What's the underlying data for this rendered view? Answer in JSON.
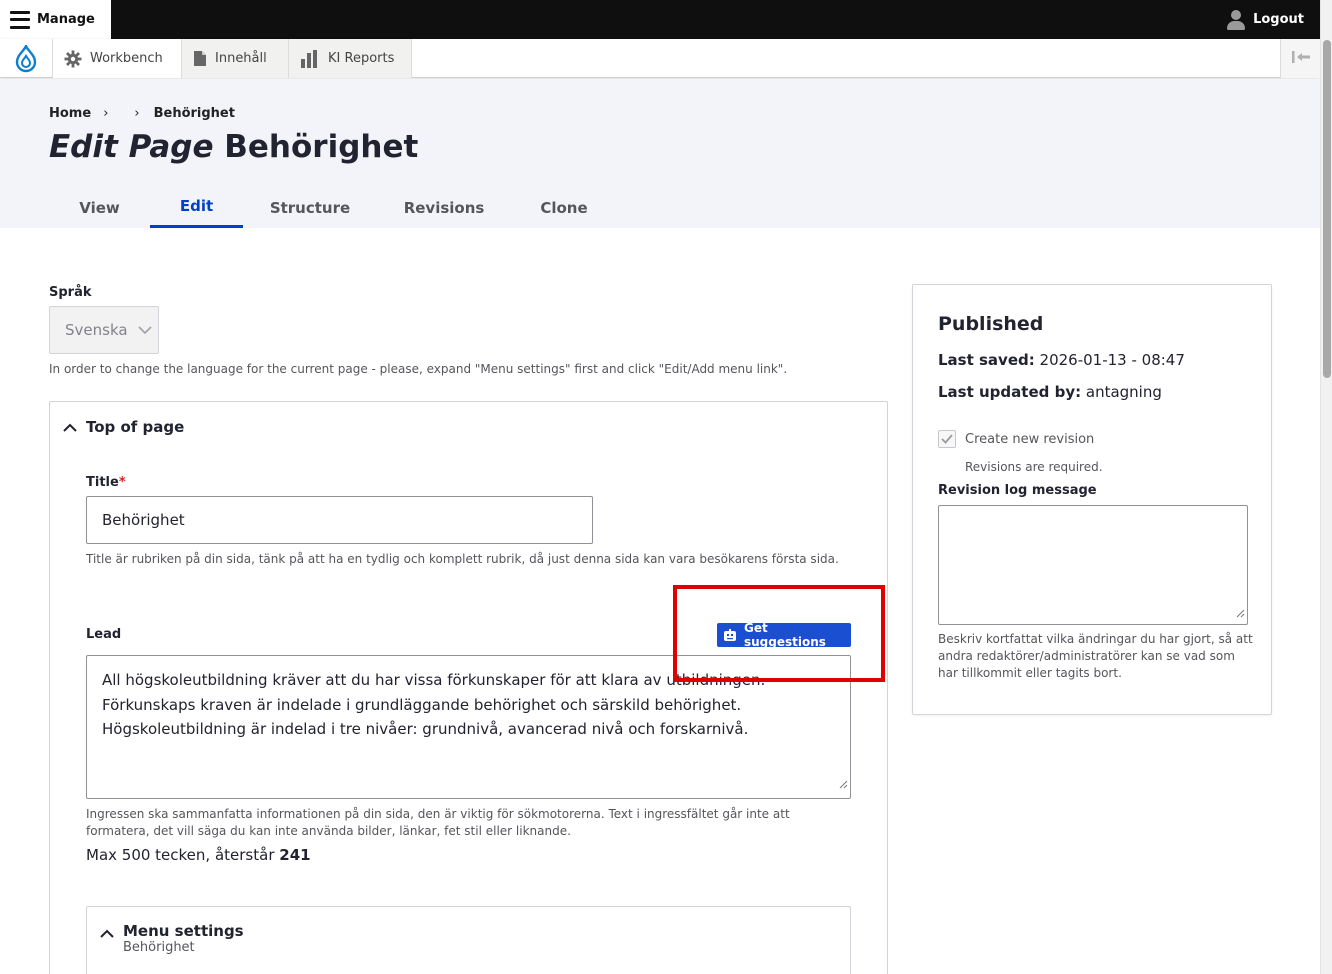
{
  "toolbar": {
    "manage_label": "Manage",
    "logout_label": "Logout"
  },
  "tray": {
    "items": [
      {
        "label": "Workbench",
        "icon": "gear-icon"
      },
      {
        "label": "Innehåll",
        "icon": "document-icon"
      },
      {
        "label": "KI Reports",
        "icon": "bar-chart-icon"
      }
    ]
  },
  "breadcrumb": {
    "home": "Home",
    "current": "Behörighet"
  },
  "page": {
    "title_prefix": "Edit Page",
    "title_name": "Behörighet"
  },
  "tabs": [
    {
      "label": "View",
      "active": false
    },
    {
      "label": "Edit",
      "active": true
    },
    {
      "label": "Structure",
      "active": false
    },
    {
      "label": "Revisions",
      "active": false
    },
    {
      "label": "Clone",
      "active": false
    }
  ],
  "language": {
    "label": "Språk",
    "value": "Svenska",
    "description": "In order to change the language for the current page - please, expand \"Menu settings\" first and click \"Edit/Add menu link\"."
  },
  "top_of_page": {
    "summary": "Top of page",
    "title_field": {
      "label": "Title",
      "required_mark": "*",
      "value": "Behörighet",
      "description": "Title är rubriken på din sida, tänk på att ha en tydlig och komplett rubrik, då just denna sida kan vara besökarens första sida."
    },
    "lead_field": {
      "label": "Lead",
      "suggest_button": "Get suggestions",
      "value": "All högskoleutbildning kräver att du har vissa förkunskaper för att klara av utbildningen. Förkunskaps kraven är indelade i grundläggande behörighet och särskild behörighet. Högskoleutbildning är indelad i tre nivåer: grundnivå, avancerad nivå och forskarnivå.",
      "description": "Ingressen ska sammanfatta informationen på din sida, den är viktig för sökmotorerna. Text i ingressfältet går inte att formatera, det vill säga du kan inte använda bilder, länkar, fet stil eller liknande.",
      "counter_text": "Max 500 tecken, återstår",
      "counter_value": "241"
    },
    "menu_settings": {
      "title": "Menu settings",
      "subtitle": "Behörighet"
    }
  },
  "meta": {
    "status": "Published",
    "last_saved_label": "Last saved:",
    "last_saved_value": "2026-01-13 - 08:47",
    "last_updated_label": "Last updated by:",
    "last_updated_value": "antagning",
    "create_revision_label": "Create new revision",
    "create_revision_checked": true,
    "revision_required_text": "Revisions are required.",
    "revision_log_label": "Revision log message",
    "revision_log_value": "",
    "revision_log_description": "Beskriv kortfattat vilka ändringar du har gjort, så att andra redaktörer/administratörer kan se vad som har tillkommit eller tagits bort."
  },
  "colors": {
    "accent": "#003ecc",
    "button": "#1b4fd1",
    "highlight_box": "#e00000",
    "header_bg": "#f3f4f9"
  }
}
